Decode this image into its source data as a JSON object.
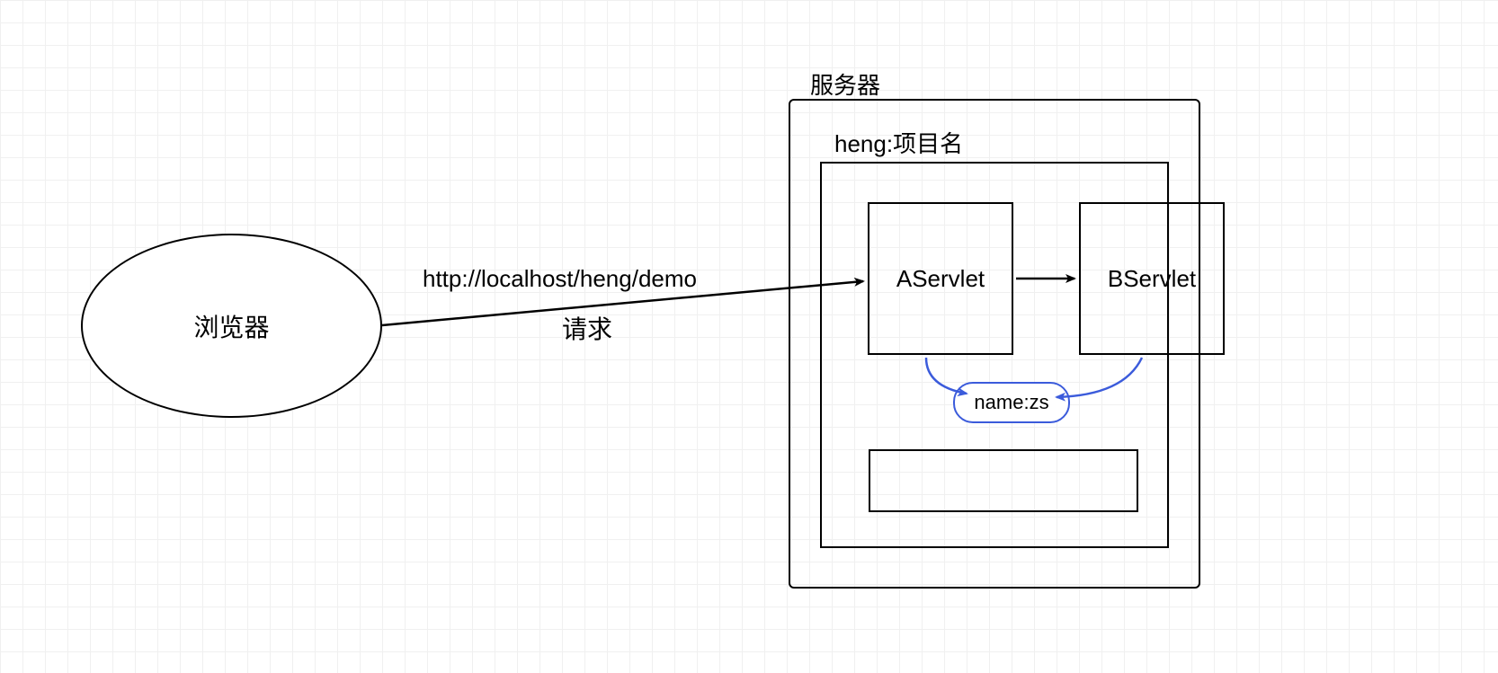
{
  "browser": {
    "label": "浏览器"
  },
  "request": {
    "url": "http://localhost/heng/demo",
    "text": "请求"
  },
  "server": {
    "title": "服务器",
    "project_label": "heng:项目名",
    "servlets": {
      "a": "AServlet",
      "b": "BServlet"
    },
    "attribute": "name:zs"
  }
}
